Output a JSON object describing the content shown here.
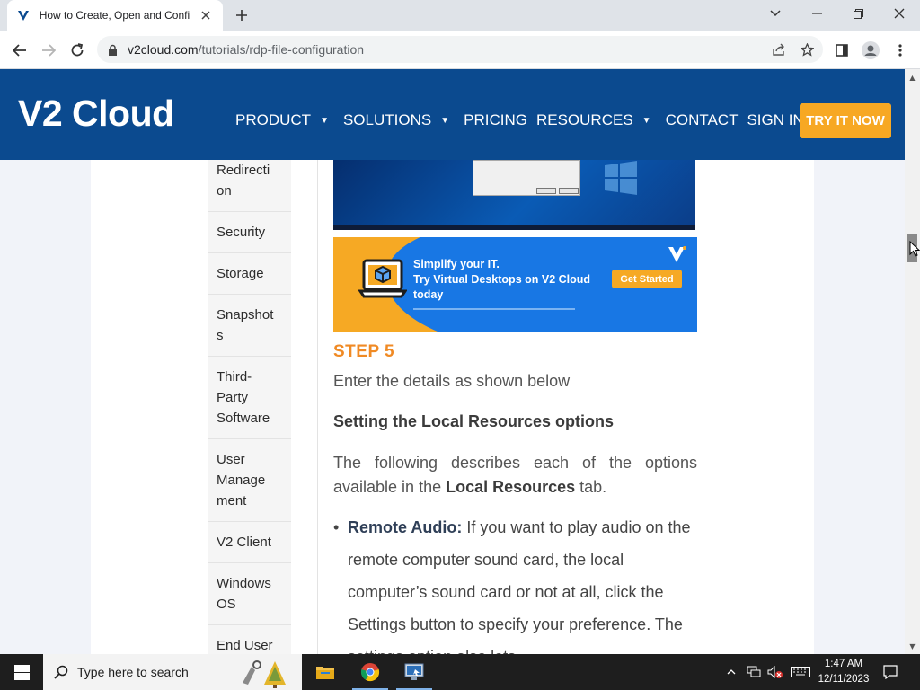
{
  "browser": {
    "tab_title": "How to Create, Open and Configure",
    "url_domain": "v2cloud.com",
    "url_path": "/tutorials/rdp-file-configuration"
  },
  "site": {
    "logo": "V2 Cloud",
    "nav": [
      {
        "label": "PRODUCT",
        "has_caret": true
      },
      {
        "label": "SOLUTIONS",
        "has_caret": true
      },
      {
        "label": "PRICING",
        "has_caret": false
      },
      {
        "label": "RESOURCES",
        "has_caret": true
      },
      {
        "label": "CONTACT",
        "has_caret": false
      },
      {
        "label": "SIGN IN",
        "has_caret": false
      }
    ],
    "cta": "TRY IT NOW"
  },
  "sidebar": {
    "items": [
      "Redirecti on",
      "Security",
      "Storage",
      "Snapshot s",
      "Third- Party Software",
      "User Manage ment",
      "V2 Client",
      "Windows OS",
      "End User"
    ]
  },
  "banner": {
    "line1": "Simplify your IT.",
    "line2": "Try Virtual Desktops on V2 Cloud",
    "line3": "today",
    "cta": "Get Started"
  },
  "article": {
    "step": "STEP 5",
    "intro": "Enter the details as shown below",
    "heading": "Setting the Local Resources options",
    "desc_before": "The following describes each of the options available in the ",
    "desc_bold": "Local Resources",
    "desc_after": " tab.",
    "bullet_label": "Remote Audio:",
    "bullet_text": " If you want to play audio on the remote computer sound card, the local computer’s sound card or not at all, click the Settings button to specify your preference. The settings option also lets"
  },
  "taskbar": {
    "search_placeholder": "Type here to search",
    "time": "1:47 AM",
    "date": "12/11/2023"
  },
  "colors": {
    "header_blue": "#0b4a8f",
    "cta_orange": "#f7a823",
    "step_orange": "#f08a24"
  }
}
